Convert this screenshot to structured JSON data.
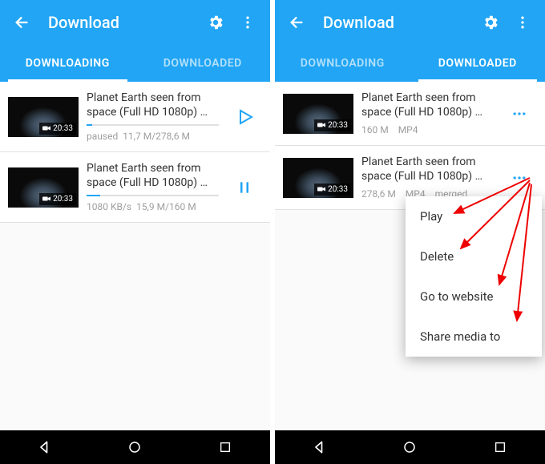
{
  "left": {
    "header": {
      "title": "Download"
    },
    "tabs": {
      "downloading": "DOWNLOADING",
      "downloaded": "DOWNLOADED",
      "active": "downloading"
    },
    "items": [
      {
        "title": "Planet Earth seen from space (Full HD 1080p) …",
        "duration": "20:33",
        "status": "paused",
        "progress_text": "11,7 M/278,6 M",
        "progress_pct": 4,
        "action": "play"
      },
      {
        "title": "Planet Earth seen from space (Full HD 1080p) …",
        "duration": "20:33",
        "status": "1080 KB/s",
        "progress_text": "15,9 M/160 M",
        "progress_pct": 10,
        "action": "pause"
      }
    ]
  },
  "right": {
    "header": {
      "title": "Download"
    },
    "tabs": {
      "downloading": "DOWNLOADING",
      "downloaded": "DOWNLOADED",
      "active": "downloaded"
    },
    "items": [
      {
        "title": "Planet Earth seen from space (Full HD 1080p) …",
        "duration": "20:33",
        "size": "160 M",
        "format": "MP4",
        "merged": ""
      },
      {
        "title": "Planet Earth seen from space (Full HD 1080p) …",
        "duration": "20:33",
        "size": "278,6 M",
        "format": "MP4",
        "merged": "merged"
      }
    ],
    "menu": {
      "play": "Play",
      "delete": "Delete",
      "goto": "Go to website",
      "share": "Share media to"
    }
  }
}
